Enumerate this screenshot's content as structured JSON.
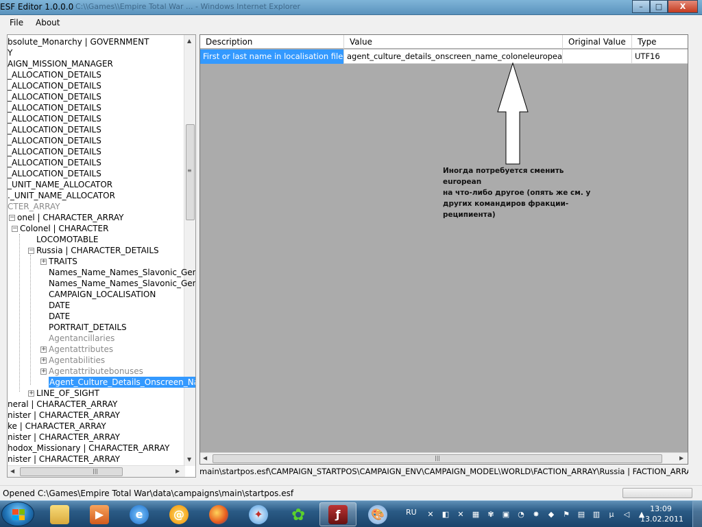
{
  "window": {
    "title": "ESF Editor 1.0.0.0",
    "subtitle": "C:\\\\Games\\\\Empire Total War ... - Windows Internet Explorer",
    "min": "–",
    "max": "□",
    "close": "X"
  },
  "menu": {
    "file": "File",
    "about": "About"
  },
  "tree": {
    "rows": [
      {
        "text": "bsolute_Monarchy | GOVERNMENT"
      },
      {
        "text": "Y"
      },
      {
        "text": "AIGN_MISSION_MANAGER"
      },
      {
        "text": "_ALLOCATION_DETAILS"
      },
      {
        "text": "_ALLOCATION_DETAILS"
      },
      {
        "text": "_ALLOCATION_DETAILS"
      },
      {
        "text": "_ALLOCATION_DETAILS"
      },
      {
        "text": "_ALLOCATION_DETAILS"
      },
      {
        "text": "_ALLOCATION_DETAILS"
      },
      {
        "text": "_ALLOCATION_DETAILS"
      },
      {
        "text": "_ALLOCATION_DETAILS"
      },
      {
        "text": "_ALLOCATION_DETAILS"
      },
      {
        "text": "_ALLOCATION_DETAILS"
      },
      {
        "text": "_UNIT_NAME_ALLOCATOR"
      },
      {
        "text": "._UNIT_NAME_ALLOCATOR"
      },
      {
        "text": "CTER_ARRAY"
      },
      {
        "text": "onel | CHARACTER_ARRAY"
      },
      {
        "text": "Colonel | CHARACTER"
      },
      {
        "text": "LOCOMOTABLE"
      },
      {
        "text": "Russia | CHARACTER_DETAILS"
      },
      {
        "text": "TRAITS"
      },
      {
        "text": "Names_Name_Names_Slavonic_Generalmaz"
      },
      {
        "text": "Names_Name_Names_Slavonic_GeneralotoIn"
      },
      {
        "text": "CAMPAIGN_LOCALISATION"
      },
      {
        "text": "DATE"
      },
      {
        "text": "DATE"
      },
      {
        "text": "PORTRAIT_DETAILS"
      },
      {
        "text": "Agentancillaries"
      },
      {
        "text": "Agentattributes"
      },
      {
        "text": "Agentabilities"
      },
      {
        "text": "Agentattributebonuses"
      },
      {
        "text": "Agent_Culture_Details_Onscreen_Name_Colo"
      },
      {
        "text": "LINE_OF_SIGHT"
      },
      {
        "text": "neral | CHARACTER_ARRAY"
      },
      {
        "text": "nister | CHARACTER_ARRAY"
      },
      {
        "text": "ke | CHARACTER_ARRAY"
      },
      {
        "text": "nister | CHARACTER_ARRAY"
      },
      {
        "text": "hodox_Missionary | CHARACTER_ARRAY"
      },
      {
        "text": "nister | CHARACTER_ARRAY"
      }
    ]
  },
  "grid": {
    "headers": [
      "Description",
      "Value",
      "Original Value",
      "Type"
    ],
    "row": {
      "description": "First or last name in localisation file",
      "value": "agent_culture_details_onscreen_name_coloneleuropean",
      "original": "",
      "type": "UTF16"
    }
  },
  "annotation": {
    "line1": "Иногда потребуется сменить european",
    "line2": "на что-либо другое (опять же см. у",
    "line3": "других командиров фракции-",
    "line4": "реципиента)"
  },
  "path": "main\\startpos.esf\\CAMPAIGN_STARTPOS\\CAMPAIGN_ENV\\CAMPAIGN_MODEL\\WORLD\\FACTION_ARRAY\\Russia | FACTION_ARRAY\\Russia",
  "status": {
    "message": "Opened C:\\Games\\Empire Total War\\data\\campaigns\\main\\startpos.esf"
  },
  "taskbar": {
    "language": "RU",
    "time": "13:09",
    "date": "13.02.2011"
  }
}
